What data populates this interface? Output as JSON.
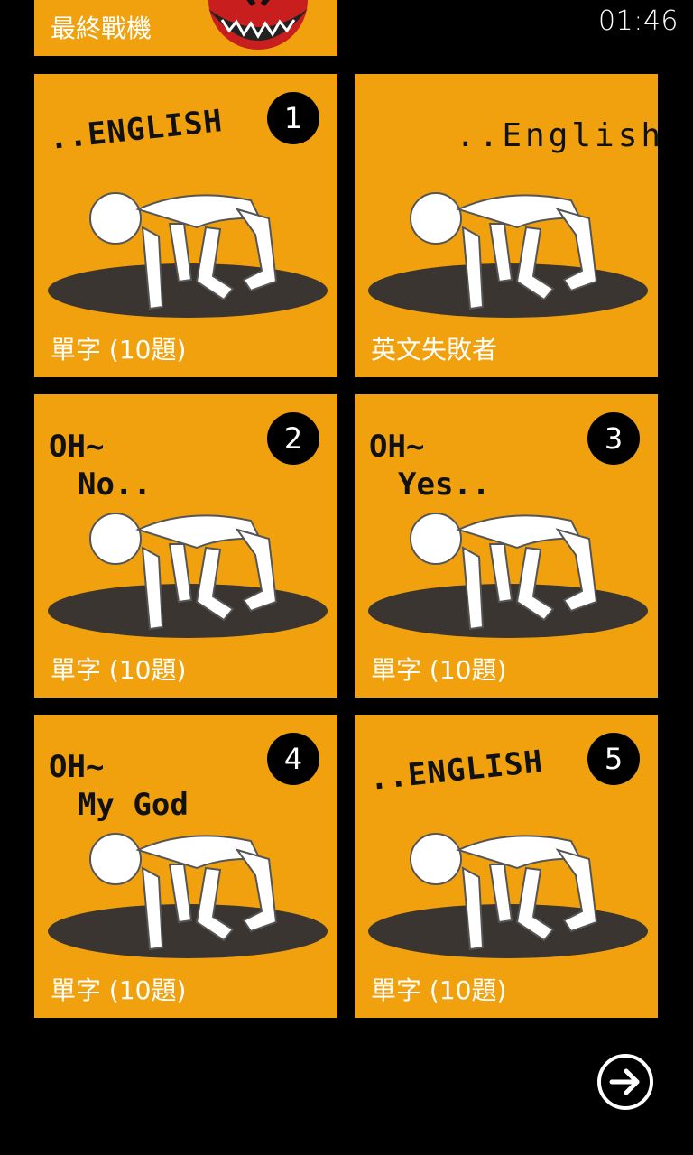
{
  "status_bar": {
    "time": "01:46"
  },
  "top_tile": {
    "label": "最終戰機"
  },
  "tiles": [
    {
      "label": "單字 (10題)",
      "badge": "1",
      "caption_lines": [
        "..ENGLISH"
      ]
    },
    {
      "label": "英文失敗者",
      "badge": "",
      "caption_lines": [
        "..English"
      ]
    },
    {
      "label": "單字 (10題)",
      "badge": "2",
      "caption_lines": [
        "OH~",
        "No.."
      ]
    },
    {
      "label": "單字 (10題)",
      "badge": "3",
      "caption_lines": [
        "OH~",
        "Yes.."
      ]
    },
    {
      "label": "單字 (10題)",
      "badge": "4",
      "caption_lines": [
        "OH~",
        "My God"
      ]
    },
    {
      "label": "單字 (10題)",
      "badge": "5",
      "caption_lines": [
        "..ENGLISH"
      ]
    }
  ],
  "colors": {
    "tile": "#f0a10d",
    "background": "#000000"
  },
  "next_icon": "arrow-right-circle-icon"
}
